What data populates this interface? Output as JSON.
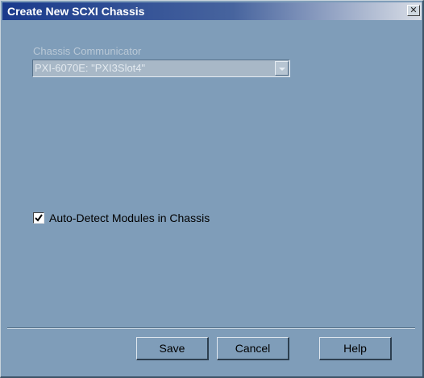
{
  "dialog": {
    "title": "Create New SCXI Chassis",
    "close_glyph": "✕"
  },
  "chassis_communicator": {
    "label": "Chassis Communicator",
    "value": "PXI-6070E: \"PXI3Slot4\"",
    "enabled": false
  },
  "auto_detect": {
    "label": "Auto-Detect Modules in Chassis",
    "checked": true
  },
  "buttons": {
    "save": "Save",
    "cancel": "Cancel",
    "help": "Help"
  },
  "colors": {
    "dialog_background": "#7f9db9",
    "title_bar_start": "#1a3a8c",
    "disabled_text": "#b9c8d6"
  },
  "icons": {
    "close": "close-icon",
    "dropdown": "chevron-down-icon",
    "check": "checkmark-icon"
  }
}
